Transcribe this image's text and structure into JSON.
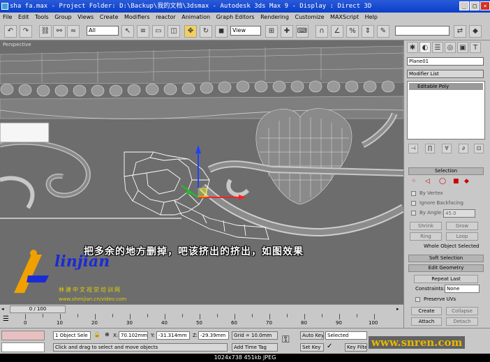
{
  "window": {
    "title": "sha fa.max   - Project Folder: D:\\Backup\\我的文档\\3dsmax   - Autodesk 3ds Max 9   - Display : Direct 3D"
  },
  "menu": [
    "File",
    "Edit",
    "Tools",
    "Group",
    "Views",
    "Create",
    "Modifiers",
    "reactor",
    "Animation",
    "Graph Editors",
    "Rendering",
    "Customize",
    "MAXScript",
    "Help"
  ],
  "toolbar": {
    "selection_filter": "All",
    "reference_coord": "View"
  },
  "viewport": {
    "label": "Perspective",
    "annotation": "把多余的地方删掉，吧该挤出的挤出，如图效果"
  },
  "logo": {
    "word": "linjian",
    "subtitle": "林建中文视觉培训网",
    "url": "www.shenjian.cn/video.com"
  },
  "command_panel": {
    "object_name": "Plane01",
    "modifier_list": "Modifier List",
    "stack_item": "Editable Poly",
    "selection_header": "Selection",
    "by_vertex": "By Vertex",
    "ignore_backfacing": "Ignore Backfacing",
    "by_angle": "By Angle:",
    "angle_value": "45.0",
    "shrink": "Shrink",
    "grow": "Grow",
    "ring": "Ring",
    "loop": "Loop",
    "whole_object": "Whole Object Selected",
    "soft_selection": "Soft Selection",
    "edit_geometry": "Edit Geometry",
    "repeat_last": "Repeat Last",
    "constraints_label": "Constraints:",
    "constraints_value": "None",
    "preserve_uvs": "Preserve UVs",
    "create": "Create",
    "collapse": "Collapse",
    "attach": "Attach",
    "detach": "Detach"
  },
  "timeline": {
    "frame_counter": "0 / 100",
    "ticks": [
      "0",
      "10",
      "20",
      "30",
      "40",
      "50",
      "60",
      "70",
      "80",
      "90",
      "100"
    ]
  },
  "status": {
    "selection_count": "1 Object Sele",
    "x_label": "X:",
    "x_value": "70.102mm",
    "y_label": "Y:",
    "y_value": "-31.314mm",
    "z_label": "Z:",
    "z_value": "-29.39mm",
    "grid": "Grid = 10.0mm",
    "auto_key": "Auto Key",
    "selected": "Selected",
    "set_key": "Set Key",
    "key_filters": "Key Filte",
    "add_time_tag": "Add Time Tag",
    "prompt": "Click and drag to select and move objects"
  },
  "watermark": "www.snren.com",
  "image_info": "1024x738  451kb  JPEG"
}
